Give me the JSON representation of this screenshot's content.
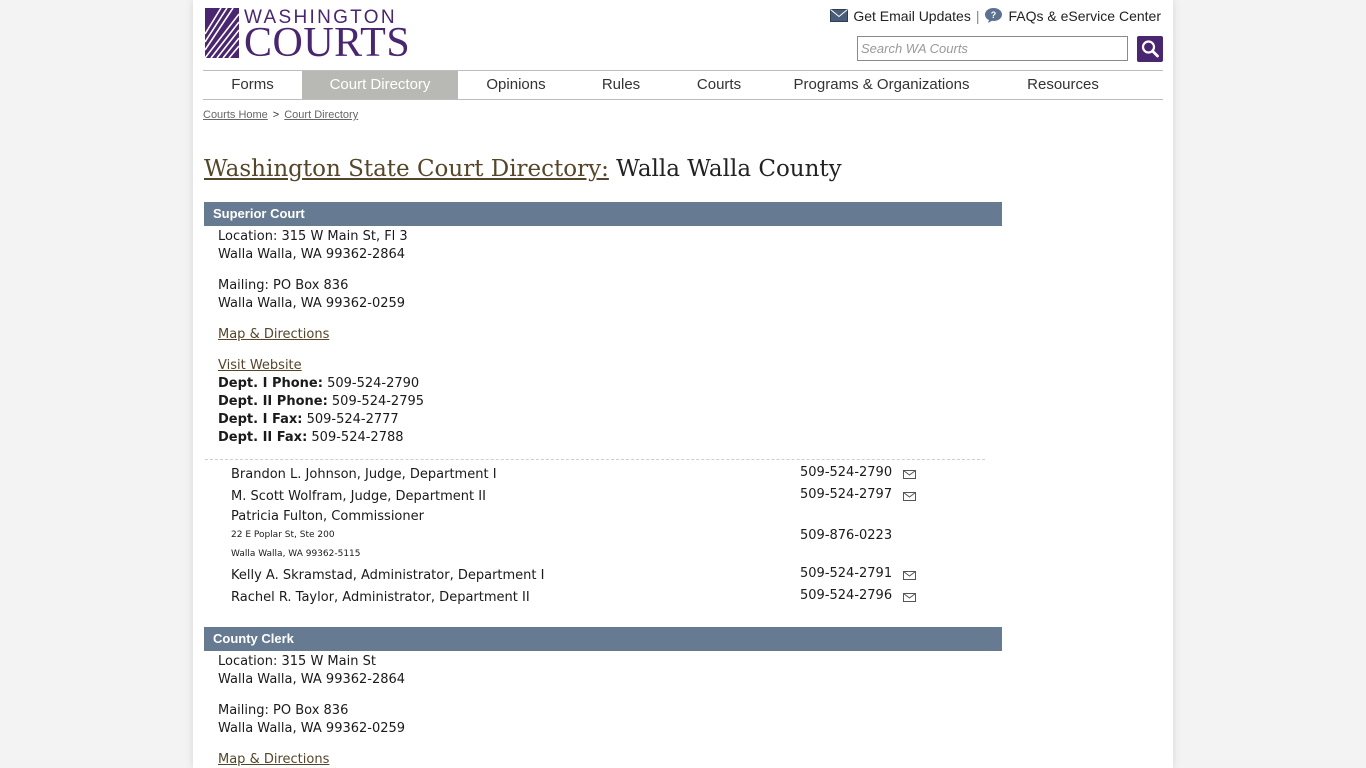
{
  "brand": {
    "top": "WASHINGTON",
    "main": "COURTS",
    "color": "#4b2670"
  },
  "header": {
    "email_updates": "Get Email Updates",
    "separator": "|",
    "faqs": "FAQs & eService Center",
    "search_placeholder": "Search WA Courts"
  },
  "nav": {
    "items": [
      {
        "label": "Forms"
      },
      {
        "label": "Court Directory",
        "active": true
      },
      {
        "label": "Opinions"
      },
      {
        "label": "Rules"
      },
      {
        "label": "Courts"
      },
      {
        "label": "Programs & Organizations"
      },
      {
        "label": "Resources"
      }
    ]
  },
  "breadcrumb": {
    "home": "Courts Home",
    "separator": ">",
    "current": "Court Directory"
  },
  "page": {
    "title_link": "Washington State Court Directory:",
    "title_rest": " Walla Walla County"
  },
  "superior": {
    "heading": "Superior Court",
    "location_line1": "Location: 315 W Main St, Fl 3",
    "location_line2": "Walla Walla, WA 99362-2864",
    "mailing_line1": "Mailing: PO Box 836",
    "mailing_line2": "Walla Walla, WA 99362-0259",
    "map_link": "Map & Directions",
    "website_link": "Visit Website",
    "phones": [
      {
        "label": "Dept. I Phone:",
        "value": " 509-524-2790"
      },
      {
        "label": "Dept. II Phone:",
        "value": " 509-524-2795"
      },
      {
        "label": "Dept. I Fax:",
        "value": " 509-524-2777"
      },
      {
        "label": "Dept. II Fax:",
        "value": " 509-524-2788"
      }
    ],
    "staff": [
      {
        "name": "Brandon L. Johnson, Judge, Department I",
        "phone": "509-524-2790"
      },
      {
        "name": "M. Scott Wolfram, Judge, Department II",
        "phone": "509-524-2797"
      },
      {
        "name": "Patricia Fulton, Commissioner",
        "addr1": "22 E Poplar St, Ste 200",
        "addr2": "Walla Walla, WA 99362-5115",
        "phone": "509-876-0223"
      },
      {
        "name": "Kelly A. Skramstad, Administrator, Department I",
        "phone": "509-524-2791"
      },
      {
        "name": "Rachel R. Taylor, Administrator, Department II",
        "phone": "509-524-2796"
      }
    ]
  },
  "clerk": {
    "heading": "County Clerk",
    "location_line1": "Location: 315 W Main St",
    "location_line2": "Walla Walla, WA 99362-2864",
    "mailing_line1": "Mailing: PO Box 836",
    "mailing_line2": "Walla Walla, WA 99362-0259",
    "map_link": "Map & Directions"
  },
  "colors": {
    "section_bar": "#667b92",
    "nav_active": "#b8b8b4",
    "link": "#55462a"
  }
}
